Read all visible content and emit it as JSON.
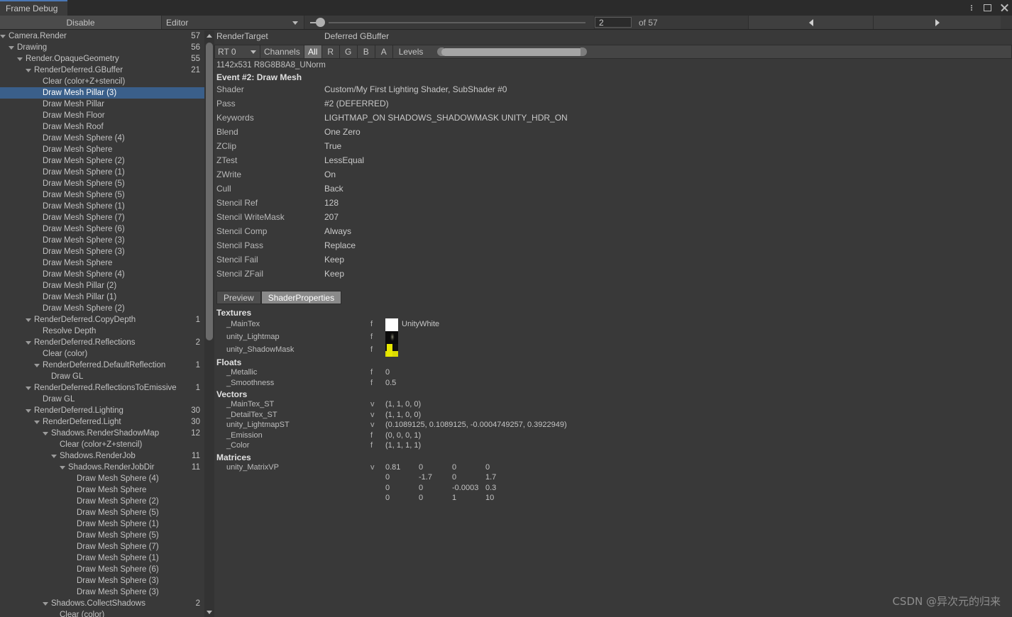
{
  "window": {
    "tab_label": "Frame Debug",
    "controls": {
      "menu": "kebab-menu",
      "maximize": "maximize",
      "close": "close"
    }
  },
  "toolbar": {
    "disable_label": "Disable",
    "target_dropdown": "Editor",
    "event_index": "2",
    "event_total_label": "of 57",
    "prev_label": "◀",
    "next_label": "▶"
  },
  "tree": {
    "rows": [
      {
        "label": "Camera.Render",
        "count": "57",
        "depth": 0,
        "expanded": true
      },
      {
        "label": "Drawing",
        "count": "56",
        "depth": 1,
        "expanded": true
      },
      {
        "label": "Render.OpaqueGeometry",
        "count": "55",
        "depth": 2,
        "expanded": true
      },
      {
        "label": "RenderDeferred.GBuffer",
        "count": "21",
        "depth": 3,
        "expanded": true
      },
      {
        "label": "Clear (color+Z+stencil)",
        "count": "",
        "depth": 4,
        "expanded": false
      },
      {
        "label": "Draw Mesh Pillar (3)",
        "count": "",
        "depth": 4,
        "expanded": false,
        "selected": true
      },
      {
        "label": "Draw Mesh Pillar",
        "count": "",
        "depth": 4,
        "expanded": false
      },
      {
        "label": "Draw Mesh Floor",
        "count": "",
        "depth": 4,
        "expanded": false
      },
      {
        "label": "Draw Mesh Roof",
        "count": "",
        "depth": 4,
        "expanded": false
      },
      {
        "label": "Draw Mesh Sphere (4)",
        "count": "",
        "depth": 4,
        "expanded": false
      },
      {
        "label": "Draw Mesh Sphere",
        "count": "",
        "depth": 4,
        "expanded": false
      },
      {
        "label": "Draw Mesh Sphere (2)",
        "count": "",
        "depth": 4,
        "expanded": false
      },
      {
        "label": "Draw Mesh Sphere (1)",
        "count": "",
        "depth": 4,
        "expanded": false
      },
      {
        "label": "Draw Mesh Sphere (5)",
        "count": "",
        "depth": 4,
        "expanded": false
      },
      {
        "label": "Draw Mesh Sphere (5)",
        "count": "",
        "depth": 4,
        "expanded": false
      },
      {
        "label": "Draw Mesh Sphere (1)",
        "count": "",
        "depth": 4,
        "expanded": false
      },
      {
        "label": "Draw Mesh Sphere (7)",
        "count": "",
        "depth": 4,
        "expanded": false
      },
      {
        "label": "Draw Mesh Sphere (6)",
        "count": "",
        "depth": 4,
        "expanded": false
      },
      {
        "label": "Draw Mesh Sphere (3)",
        "count": "",
        "depth": 4,
        "expanded": false
      },
      {
        "label": "Draw Mesh Sphere (3)",
        "count": "",
        "depth": 4,
        "expanded": false
      },
      {
        "label": "Draw Mesh Sphere",
        "count": "",
        "depth": 4,
        "expanded": false
      },
      {
        "label": "Draw Mesh Sphere (4)",
        "count": "",
        "depth": 4,
        "expanded": false
      },
      {
        "label": "Draw Mesh Pillar (2)",
        "count": "",
        "depth": 4,
        "expanded": false
      },
      {
        "label": "Draw Mesh Pillar (1)",
        "count": "",
        "depth": 4,
        "expanded": false
      },
      {
        "label": "Draw Mesh Sphere (2)",
        "count": "",
        "depth": 4,
        "expanded": false
      },
      {
        "label": "RenderDeferred.CopyDepth",
        "count": "1",
        "depth": 3,
        "expanded": true
      },
      {
        "label": "Resolve Depth",
        "count": "",
        "depth": 4,
        "expanded": false
      },
      {
        "label": "RenderDeferred.Reflections",
        "count": "2",
        "depth": 3,
        "expanded": true
      },
      {
        "label": "Clear (color)",
        "count": "",
        "depth": 4,
        "expanded": false
      },
      {
        "label": "RenderDeferred.DefaultReflection",
        "count": "1",
        "depth": 4,
        "expanded": true
      },
      {
        "label": "Draw GL",
        "count": "",
        "depth": 5,
        "expanded": false
      },
      {
        "label": "RenderDeferred.ReflectionsToEmissive",
        "count": "1",
        "depth": 3,
        "expanded": true
      },
      {
        "label": "Draw GL",
        "count": "",
        "depth": 4,
        "expanded": false
      },
      {
        "label": "RenderDeferred.Lighting",
        "count": "30",
        "depth": 3,
        "expanded": true
      },
      {
        "label": "RenderDeferred.Light",
        "count": "30",
        "depth": 4,
        "expanded": true
      },
      {
        "label": "Shadows.RenderShadowMap",
        "count": "12",
        "depth": 5,
        "expanded": true
      },
      {
        "label": "Clear (color+Z+stencil)",
        "count": "",
        "depth": 6,
        "expanded": false
      },
      {
        "label": "Shadows.RenderJob",
        "count": "11",
        "depth": 6,
        "expanded": true
      },
      {
        "label": "Shadows.RenderJobDir",
        "count": "11",
        "depth": 7,
        "expanded": true
      },
      {
        "label": "Draw Mesh Sphere (4)",
        "count": "",
        "depth": 8,
        "expanded": false
      },
      {
        "label": "Draw Mesh Sphere",
        "count": "",
        "depth": 8,
        "expanded": false
      },
      {
        "label": "Draw Mesh Sphere (2)",
        "count": "",
        "depth": 8,
        "expanded": false
      },
      {
        "label": "Draw Mesh Sphere (5)",
        "count": "",
        "depth": 8,
        "expanded": false
      },
      {
        "label": "Draw Mesh Sphere (1)",
        "count": "",
        "depth": 8,
        "expanded": false
      },
      {
        "label": "Draw Mesh Sphere (5)",
        "count": "",
        "depth": 8,
        "expanded": false
      },
      {
        "label": "Draw Mesh Sphere (7)",
        "count": "",
        "depth": 8,
        "expanded": false
      },
      {
        "label": "Draw Mesh Sphere (1)",
        "count": "",
        "depth": 8,
        "expanded": false
      },
      {
        "label": "Draw Mesh Sphere (6)",
        "count": "",
        "depth": 8,
        "expanded": false
      },
      {
        "label": "Draw Mesh Sphere (3)",
        "count": "",
        "depth": 8,
        "expanded": false
      },
      {
        "label": "Draw Mesh Sphere (3)",
        "count": "",
        "depth": 8,
        "expanded": false
      },
      {
        "label": "Shadows.CollectShadows",
        "count": "2",
        "depth": 5,
        "expanded": true
      },
      {
        "label": "Clear (color)",
        "count": "",
        "depth": 6,
        "expanded": false
      }
    ]
  },
  "render_target": {
    "label": "RenderTarget",
    "value": "Deferred GBuffer",
    "rt_select": "RT 0",
    "channels_label": "Channels",
    "channels": [
      {
        "label": "All",
        "active": true
      },
      {
        "label": "R",
        "active": false
      },
      {
        "label": "G",
        "active": false
      },
      {
        "label": "B",
        "active": false
      },
      {
        "label": "A",
        "active": false
      }
    ],
    "levels_label": "Levels",
    "format": "1142x531 R8G8B8A8_UNorm"
  },
  "event": {
    "title": "Event #2: Draw Mesh",
    "properties": [
      {
        "key": "Shader",
        "value": "Custom/My First Lighting Shader, SubShader #0"
      },
      {
        "key": "Pass",
        "value": "#2 (DEFERRED)"
      },
      {
        "key": "Keywords",
        "value": "LIGHTMAP_ON SHADOWS_SHADOWMASK UNITY_HDR_ON"
      },
      {
        "key": "Blend",
        "value": "One Zero"
      },
      {
        "key": "ZClip",
        "value": "True"
      },
      {
        "key": "ZTest",
        "value": "LessEqual"
      },
      {
        "key": "ZWrite",
        "value": "On"
      },
      {
        "key": "Cull",
        "value": "Back"
      },
      {
        "key": "Stencil Ref",
        "value": "128"
      },
      {
        "key": "Stencil WriteMask",
        "value": "207"
      },
      {
        "key": "Stencil Comp",
        "value": "Always"
      },
      {
        "key": "Stencil Pass",
        "value": "Replace"
      },
      {
        "key": "Stencil Fail",
        "value": "Keep"
      },
      {
        "key": "Stencil ZFail",
        "value": "Keep"
      }
    ]
  },
  "panel_tabs": [
    {
      "label": "Preview",
      "active": false
    },
    {
      "label": "ShaderProperties",
      "active": true
    }
  ],
  "shader_properties": {
    "textures_header": "Textures",
    "textures": [
      {
        "name": "_MainTex",
        "type": "f",
        "thumb": "white",
        "value": "UnityWhite"
      },
      {
        "name": "unity_Lightmap",
        "type": "f",
        "thumb": "lightmap",
        "value": ""
      },
      {
        "name": "unity_ShadowMask",
        "type": "f",
        "thumb": "shadowmask",
        "value": ""
      }
    ],
    "floats_header": "Floats",
    "floats": [
      {
        "name": "_Metallic",
        "type": "f",
        "value": "0"
      },
      {
        "name": "_Smoothness",
        "type": "f",
        "value": "0.5"
      }
    ],
    "vectors_header": "Vectors",
    "vectors": [
      {
        "name": "_MainTex_ST",
        "type": "v",
        "value": "(1, 1, 0, 0)"
      },
      {
        "name": "_DetailTex_ST",
        "type": "v",
        "value": "(1, 1, 0, 0)"
      },
      {
        "name": "unity_LightmapST",
        "type": "v",
        "value": "(0.1089125, 0.1089125, -0.0004749257, 0.3922949)"
      },
      {
        "name": "_Emission",
        "type": "f",
        "value": "(0, 0, 0, 1)"
      },
      {
        "name": "_Color",
        "type": "f",
        "value": "(1, 1, 1, 1)"
      }
    ],
    "matrices_header": "Matrices",
    "matrices": [
      {
        "name": "unity_MatrixVP",
        "type": "v",
        "rows": [
          [
            "0.81",
            "0",
            "0",
            "0"
          ],
          [
            "0",
            "-1.7",
            "0",
            "1.7"
          ],
          [
            "0",
            "0",
            "-0.0003",
            "0.3"
          ],
          [
            "0",
            "0",
            "1",
            "10"
          ]
        ]
      }
    ]
  },
  "watermark": "CSDN @异次元的归来",
  "colors": {
    "background": "#393939",
    "selection": "#3a5f8a",
    "tab_accent": "#4a77b5",
    "titlebar": "#2b2b2b"
  }
}
